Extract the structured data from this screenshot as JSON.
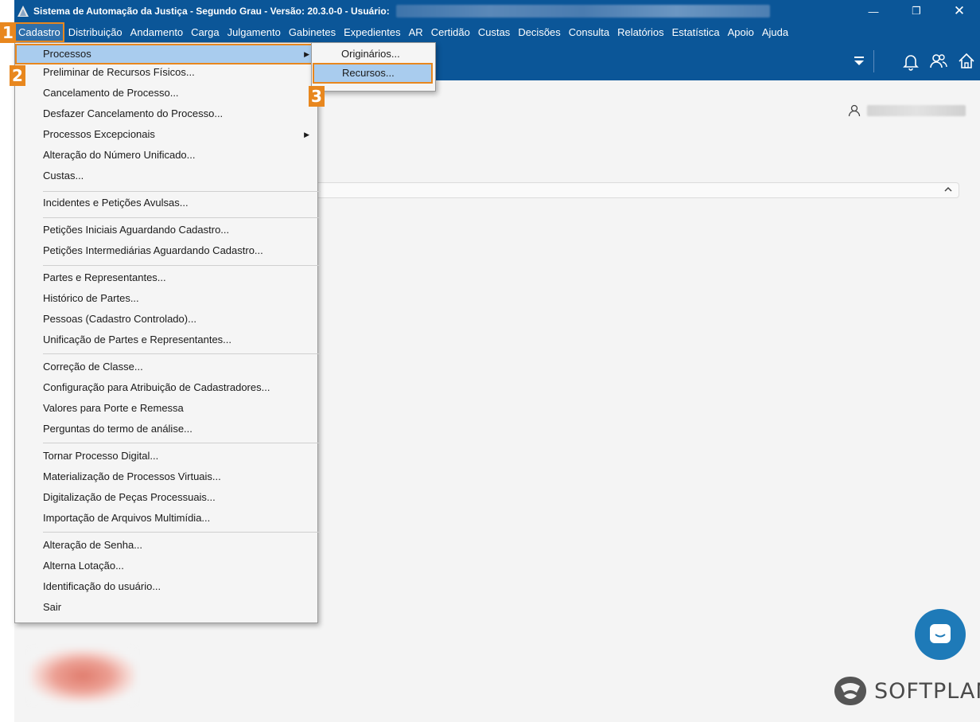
{
  "window": {
    "title": "Sistema de Automação da Justiça - Segundo Grau - Versão: 20.3.0-0 - Usuário:",
    "minimize_glyph": "—",
    "restore_glyph": "❐",
    "close_glyph": "✕"
  },
  "menubar": {
    "items": [
      "Cadastro",
      "Distribuição",
      "Andamento",
      "Carga",
      "Julgamento",
      "Gabinetes",
      "Expedientes",
      "AR",
      "Certidão",
      "Custas",
      "Decisões",
      "Consulta",
      "Relatórios",
      "Estatística",
      "Apoio",
      "Ajuda"
    ],
    "active": "Cadastro"
  },
  "toolbar": {
    "icons": [
      "filter-icon",
      "bell-icon",
      "users-icon",
      "home-icon"
    ]
  },
  "cadastro_menu": {
    "items": [
      {
        "label": "Processos",
        "submenu": true,
        "selected": true
      },
      {
        "label": "Preliminar de Recursos Físicos..."
      },
      {
        "label": "Cancelamento de Processo..."
      },
      {
        "label": "Desfazer Cancelamento do Processo..."
      },
      {
        "label": "Processos Excepcionais",
        "submenu": true
      },
      {
        "label": "Alteração do Número Unificado..."
      },
      {
        "label": "Custas..."
      },
      {
        "label": "Incidentes e Petições Avulsas..."
      },
      {
        "label": "Petições Iniciais Aguardando Cadastro..."
      },
      {
        "label": "Petições Intermediárias Aguardando Cadastro..."
      },
      {
        "label": "Partes e Representantes..."
      },
      {
        "label": "Histórico de Partes..."
      },
      {
        "label": "Pessoas (Cadastro Controlado)..."
      },
      {
        "label": "Unificação de Partes e Representantes..."
      },
      {
        "label": "Correção de Classe..."
      },
      {
        "label": "Configuração para Atribuição de Cadastradores..."
      },
      {
        "label": "Valores para Porte e Remessa"
      },
      {
        "label": "Perguntas do termo de análise..."
      },
      {
        "label": "Tornar Processo Digital..."
      },
      {
        "label": "Materialização de Processos Virtuais..."
      },
      {
        "label": "Digitalização de Peças Processuais..."
      },
      {
        "label": "Importação de Arquivos Multimídia..."
      },
      {
        "label": "Alteração de Senha..."
      },
      {
        "label": "Alterna Lotação..."
      },
      {
        "label": "Identificação do usuário..."
      },
      {
        "label": "Sair"
      }
    ]
  },
  "processos_submenu": {
    "items": [
      {
        "label": "Originários..."
      },
      {
        "label": "Recursos...",
        "selected": true
      }
    ]
  },
  "step_badges": [
    "1",
    "2",
    "3"
  ],
  "brand": {
    "name": "SOFTPLAN",
    "accent": "#e8871e",
    "primary": "#0b5698"
  }
}
